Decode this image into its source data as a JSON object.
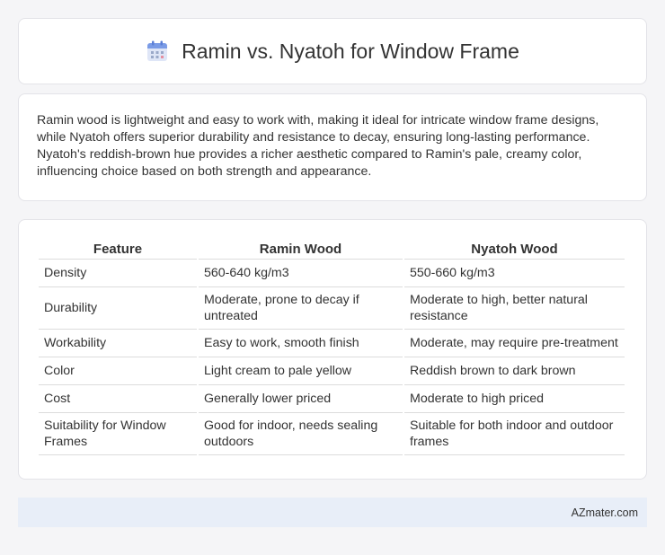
{
  "header": {
    "title": "Ramin vs. Nyatoh for Window Frame",
    "icon": "calendar-icon"
  },
  "summary": {
    "text": "Ramin wood is lightweight and easy to work with, making it ideal for intricate window frame designs, while Nyatoh offers superior durability and resistance to decay, ensuring long-lasting performance. Nyatoh's reddish-brown hue provides a richer aesthetic compared to Ramin's pale, creamy color, influencing choice based on both strength and appearance."
  },
  "table": {
    "headers": [
      "Feature",
      "Ramin Wood",
      "Nyatoh Wood"
    ],
    "rows": [
      [
        "Density",
        "560-640 kg/m3",
        "550-660 kg/m3"
      ],
      [
        "Durability",
        "Moderate, prone to decay if untreated",
        "Moderate to high, better natural resistance"
      ],
      [
        "Workability",
        "Easy to work, smooth finish",
        "Moderate, may require pre-treatment"
      ],
      [
        "Color",
        "Light cream to pale yellow",
        "Reddish brown to dark brown"
      ],
      [
        "Cost",
        "Generally lower priced",
        "Moderate to high priced"
      ],
      [
        "Suitability for Window Frames",
        "Good for indoor, needs sealing outdoors",
        "Suitable for both indoor and outdoor frames"
      ]
    ]
  },
  "footer": {
    "site": "AZmater.com"
  },
  "colors": {
    "accent": "#6a8de0",
    "footer_bg": "#e8eef8"
  }
}
